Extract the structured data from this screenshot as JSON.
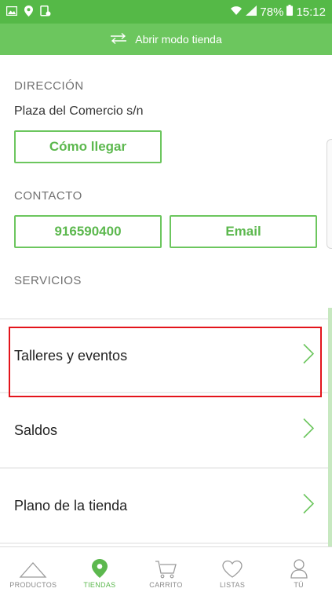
{
  "status_bar": {
    "battery": "78%",
    "time": "15:12"
  },
  "mode_bar": {
    "label": "Abrir modo tienda"
  },
  "address": {
    "title": "DIRECCIÓN",
    "text": "Plaza del Comercio s/n",
    "directions_label": "Cómo llegar"
  },
  "contact": {
    "title": "CONTACTO",
    "phone": "916590400",
    "email_label": "Email"
  },
  "services": {
    "title": "SERVICIOS",
    "items": [
      {
        "label": "Talleres y eventos"
      },
      {
        "label": "Saldos"
      },
      {
        "label": "Plano de la tienda"
      }
    ]
  },
  "bottom_nav": {
    "items": [
      {
        "label": "PRODUCTOS",
        "icon": "triangle-icon"
      },
      {
        "label": "TIENDAS",
        "icon": "location-pin-icon",
        "active": true
      },
      {
        "label": "CARRITO",
        "icon": "cart-icon"
      },
      {
        "label": "LISTAS",
        "icon": "heart-icon"
      },
      {
        "label": "TÚ",
        "icon": "user-icon"
      }
    ]
  },
  "colors": {
    "status_bar": "#55b947",
    "accent": "#6cc65e",
    "accent_text": "#5cb84e",
    "highlight": "#e3141b"
  }
}
